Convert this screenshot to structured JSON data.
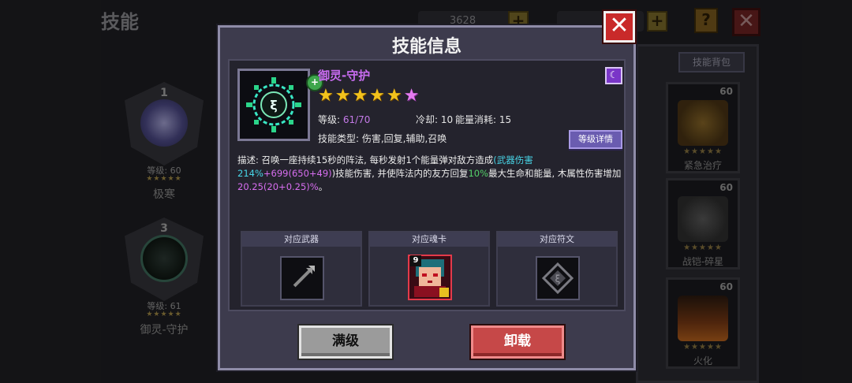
{
  "background": {
    "title": "技能",
    "resource1_value": "3628",
    "plus_symbol": "+",
    "help_symbol": "?",
    "close_symbol": "✕",
    "slots": [
      {
        "number": "1",
        "level": "等级: 60",
        "stars": "★★★★★",
        "name": "极寒"
      },
      {
        "number": "3",
        "level": "等级: 61",
        "stars": "★★★★★",
        "name": "御灵-守护"
      }
    ],
    "bag_tab": "技能背包",
    "cards": [
      {
        "level": "60",
        "stars": "★★★★★",
        "name": "紧急治疗"
      },
      {
        "level": "60",
        "stars": "★★★★★",
        "name": "战铠-碎星"
      },
      {
        "level": "60",
        "stars": "★★★★★",
        "name": "火化"
      }
    ]
  },
  "modal": {
    "title": "技能信息",
    "close_symbol": "✕",
    "skill": {
      "name": "御灵-守护",
      "rarity_badge": "+",
      "moon_badge": "☾",
      "stars_gold": "★★★★★",
      "stars_pink": "★",
      "level_label": "等级: ",
      "level_value": "61/70",
      "cooldown_label": "冷却: ",
      "cooldown_value": "10",
      "energy_label": "能量消耗: ",
      "energy_value": "15",
      "type_label": "技能类型: ",
      "type_value": "伤害,回复,辅助,召唤"
    },
    "detail_button": "等级详情",
    "description": {
      "p1": "描述: 召唤一座持续15秒的阵法, 每秒发射1个能量弹对敌方造成",
      "p2": "(武器伤害214%",
      "p3": "+699(6",
      "p4": "50+49)",
      "p5": ")技能伤害, 并使阵法内的友方回复",
      "p6": "10%",
      "p7": "最大生命和能量, 木属性伤害增加",
      "p8": "20.25(",
      "p9": "20+0.25)",
      "p10": "%",
      "p11": "。"
    },
    "relations": [
      {
        "header": "对应武器"
      },
      {
        "header": "对应魂卡",
        "card_level": "9"
      },
      {
        "header": "对应符文"
      }
    ],
    "max_button": "满级",
    "unload_button": "卸载"
  }
}
